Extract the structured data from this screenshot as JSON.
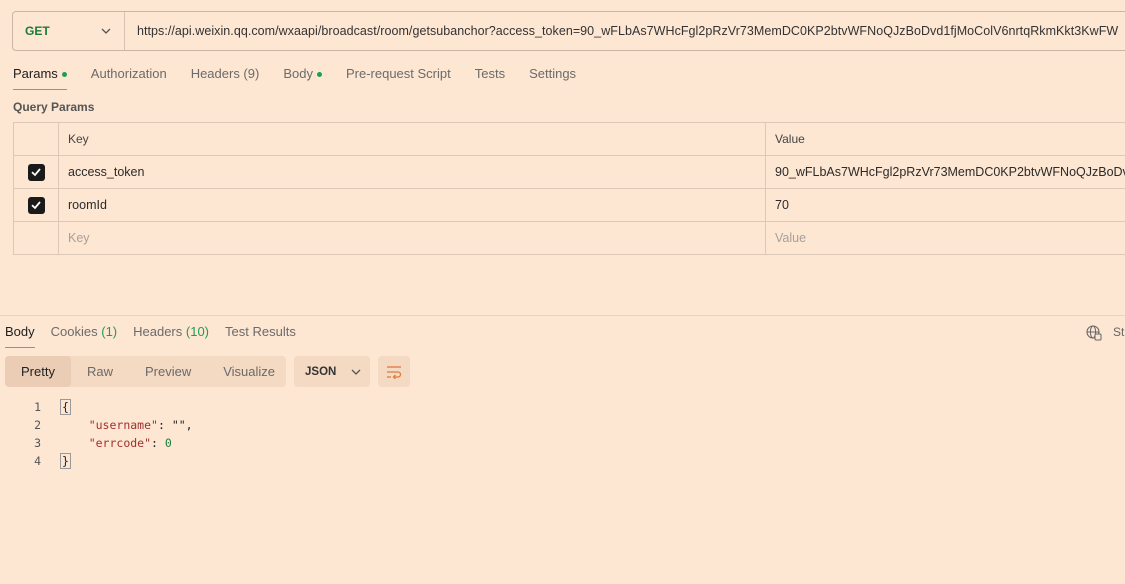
{
  "request": {
    "method": "GET",
    "url": "https://api.weixin.qq.com/wxaapi/broadcast/room/getsubanchor?access_token=90_wFLbAs7WHcFgl2pRzVr73MemDC0KP2btvWFNoQJzBoDvd1fjMoColV6nrtqRkmKkt3KwFW"
  },
  "request_tabs": [
    {
      "label": "Params",
      "dot": true
    },
    {
      "label": "Authorization",
      "dot": false
    },
    {
      "label": "Headers (9)",
      "dot": false
    },
    {
      "label": "Body",
      "dot": true
    },
    {
      "label": "Pre-request Script",
      "dot": false
    },
    {
      "label": "Tests",
      "dot": false
    },
    {
      "label": "Settings",
      "dot": false
    }
  ],
  "query_params": {
    "section_label": "Query Params",
    "headers": {
      "key": "Key",
      "value": "Value"
    },
    "rows": [
      {
        "checked": true,
        "key": "access_token",
        "value": "90_wFLbAs7WHcFgl2pRzVr73MemDC0KP2btvWFNoQJzBoDv"
      },
      {
        "checked": true,
        "key": "roomId",
        "value": "70"
      }
    ],
    "placeholder": {
      "key": "Key",
      "value": "Value"
    }
  },
  "response": {
    "tabs": [
      {
        "label": "Body",
        "count": ""
      },
      {
        "label": "Cookies",
        "count": "(1)"
      },
      {
        "label": "Headers",
        "count": "(10)"
      },
      {
        "label": "Test Results",
        "count": ""
      }
    ],
    "status_label": "St",
    "view_modes": [
      "Pretty",
      "Raw",
      "Preview",
      "Visualize"
    ],
    "format": "JSON",
    "code_lines": [
      {
        "num": "1",
        "text": "{"
      },
      {
        "num": "2",
        "key": "\"username\"",
        "sep": ": ",
        "val": "\"\","
      },
      {
        "num": "3",
        "key": "\"errcode\"",
        "sep": ": ",
        "val": "0"
      },
      {
        "num": "4",
        "text": "}"
      }
    ]
  },
  "colors": {
    "background": "#fde6d2",
    "accent": "#e07a3f",
    "method_green": "#1f7a3a",
    "dot_green": "#1f9d55"
  }
}
